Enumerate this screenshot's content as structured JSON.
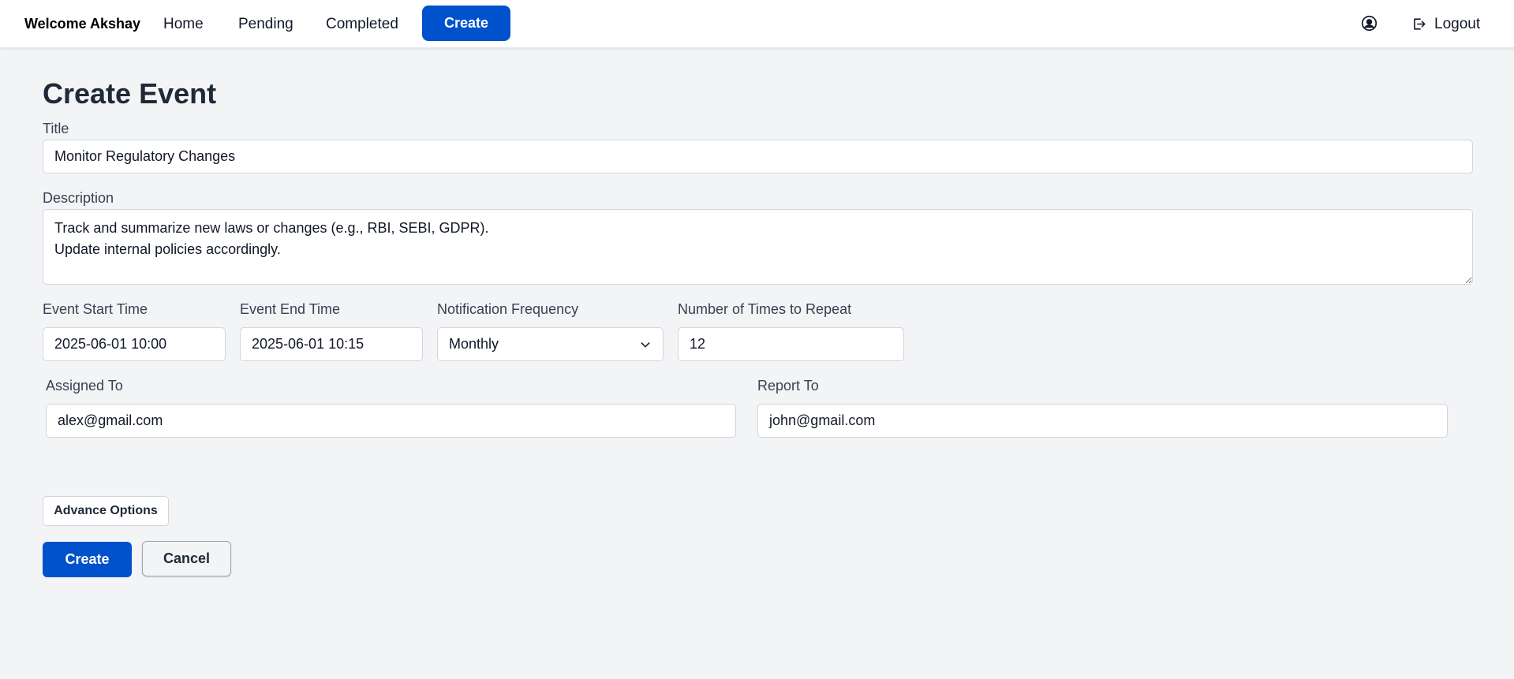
{
  "nav": {
    "welcome": "Welcome Akshay",
    "home": "Home",
    "pending": "Pending",
    "completed": "Completed",
    "create": "Create",
    "logout": "Logout"
  },
  "page": {
    "title": "Create Event"
  },
  "form": {
    "title_label": "Title",
    "title_value": "Monitor Regulatory Changes",
    "description_label": "Description",
    "description_value": "Track and summarize new laws or changes (e.g., RBI, SEBI, GDPR).\nUpdate internal policies accordingly.",
    "start_label": "Event Start Time",
    "start_value": "2025-06-01 10:00",
    "end_label": "Event End Time",
    "end_value": "2025-06-01 10:15",
    "frequency_label": "Notification Frequency",
    "frequency_value": "Monthly",
    "repeat_label": "Number of Times to Repeat",
    "repeat_value": "12",
    "assigned_label": "Assigned To",
    "assigned_value": "alex@gmail.com",
    "report_label": "Report To",
    "report_value": "john@gmail.com",
    "advance_label": "Advance Options",
    "create_label": "Create",
    "cancel_label": "Cancel"
  },
  "icons": {
    "profile": "user-circle-icon",
    "logout": "logout-icon",
    "chevron": "chevron-down-icon"
  },
  "colors": {
    "primary": "#0052cc",
    "background": "#f3f4f6"
  }
}
